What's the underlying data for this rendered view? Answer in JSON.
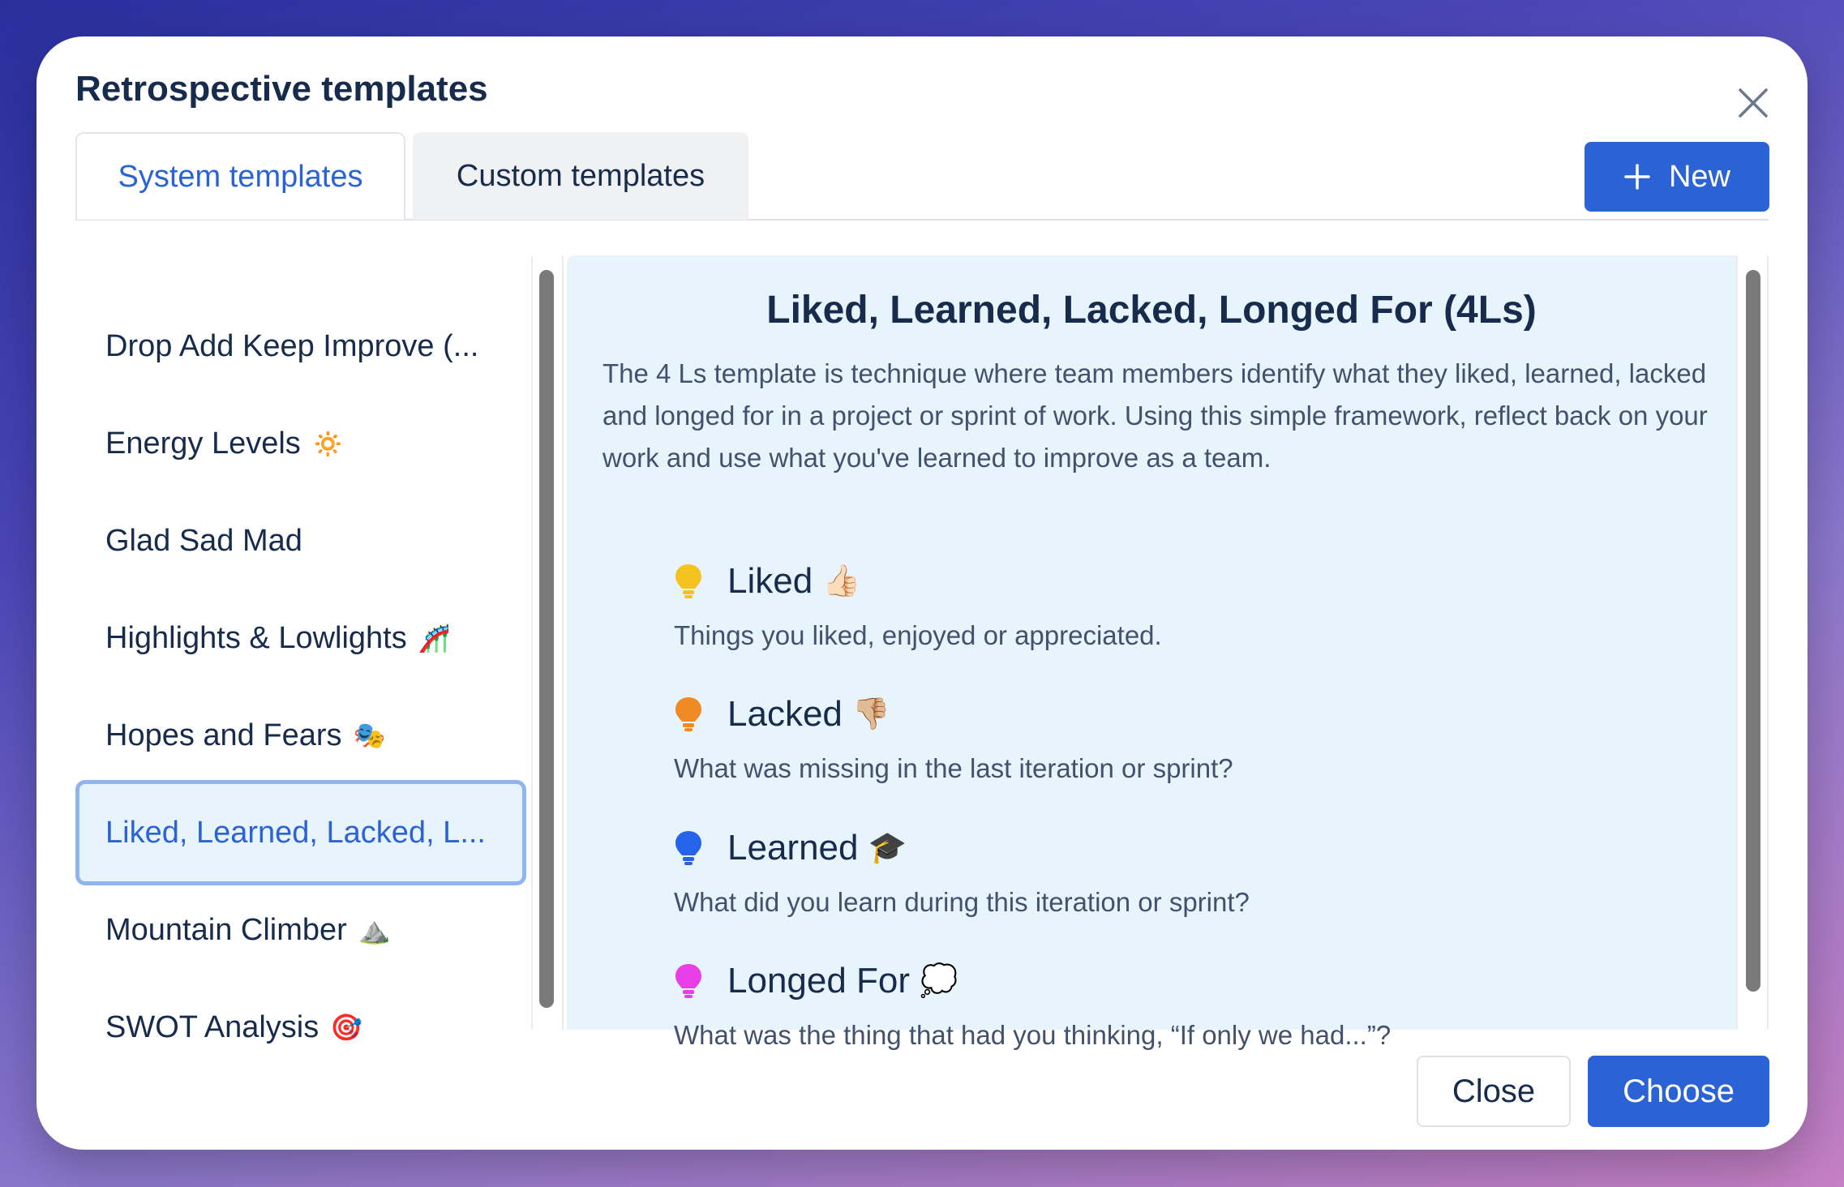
{
  "dialog": {
    "title": "Retrospective templates",
    "close_icon": "close-icon"
  },
  "tabs": [
    {
      "label": "System templates",
      "active": true
    },
    {
      "label": "Custom templates",
      "active": false
    }
  ],
  "new_button": {
    "label": "New",
    "icon": "plus-icon"
  },
  "sidebar": {
    "items": [
      {
        "label": "Drop Add Keep Improve (...",
        "emoji": ""
      },
      {
        "label": "Energy Levels",
        "emoji": "🔅"
      },
      {
        "label": "Glad Sad Mad",
        "emoji": ""
      },
      {
        "label": "Highlights & Lowlights",
        "emoji": "🎢"
      },
      {
        "label": "Hopes and Fears",
        "emoji": "🎭"
      },
      {
        "label": "Liked, Learned, Lacked, L...",
        "emoji": ""
      },
      {
        "label": "Mountain Climber",
        "emoji": "⛰️"
      },
      {
        "label": "SWOT Analysis",
        "emoji": "🎯"
      }
    ],
    "selected_index": 5
  },
  "detail": {
    "title": "Liked, Learned, Lacked, Longed For (4Ls)",
    "description": "The 4 Ls template is technique where team members identify what they liked, learned, lacked and longed for in a project or sprint of work. Using this simple framework, reflect back on your work and use what you've learned to improve as a team.",
    "sections": [
      {
        "name": "Liked",
        "emoji": "👍🏻",
        "text": "Things you liked, enjoyed or appreciated.",
        "color": "#f5c320"
      },
      {
        "name": "Lacked",
        "emoji": "👎🏼",
        "text": "What was missing in the last iteration or sprint?",
        "color": "#f08a24"
      },
      {
        "name": "Learned",
        "emoji": "🎓",
        "text": "What did you learn during this iteration or sprint?",
        "color": "#2563eb"
      },
      {
        "name": "Longed For",
        "emoji": "💭",
        "text": "What was the thing that had you thinking, “If only we had...”?",
        "color": "#e83ee8"
      }
    ]
  },
  "footer": {
    "close_label": "Close",
    "choose_label": "Choose"
  },
  "colors": {
    "accent": "#2b63d6",
    "selected_bg": "#e8f4fb",
    "selected_border": "#8fb4f0"
  }
}
